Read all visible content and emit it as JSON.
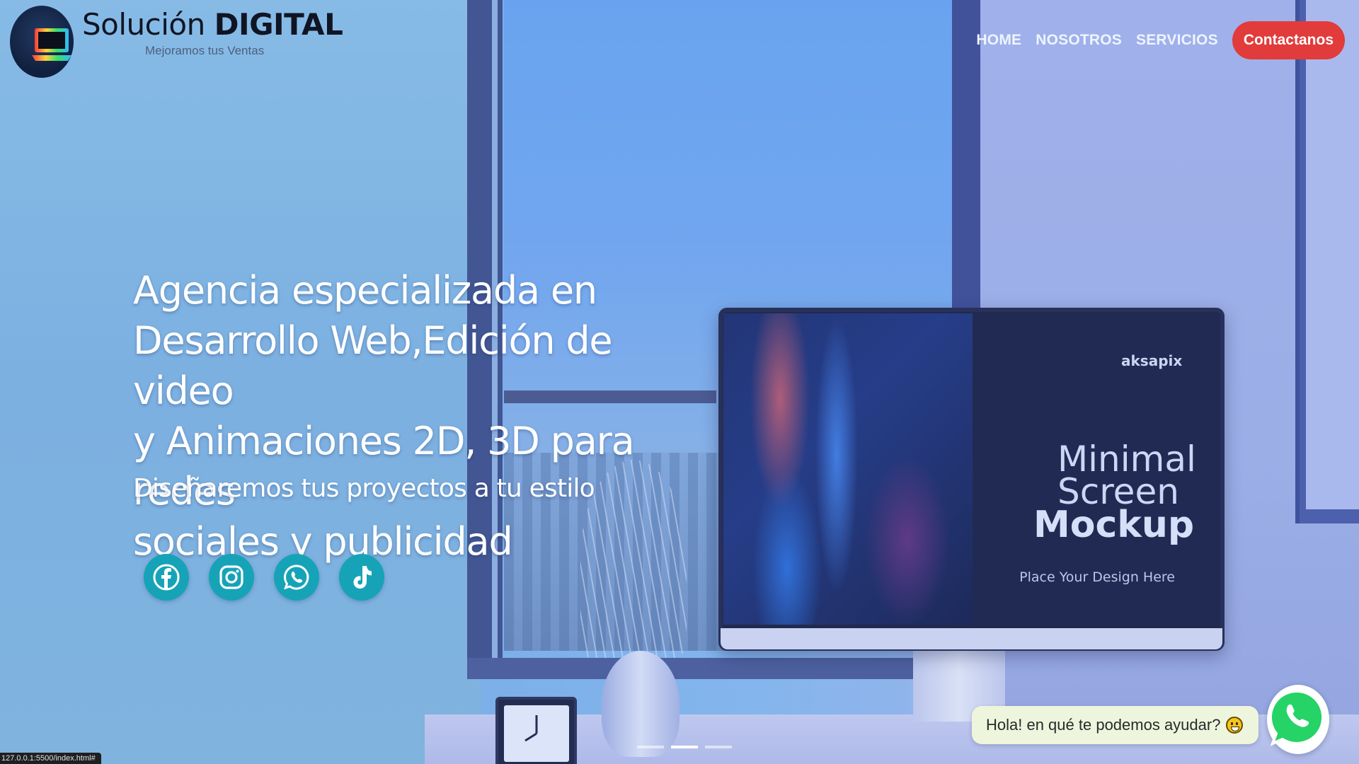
{
  "brand": {
    "name_light": "Solución ",
    "name_bold": "DIGITAL",
    "tagline": "Mejoramos tus Ventas",
    "logo_icon": "laptop-icon"
  },
  "nav": {
    "items": [
      {
        "label": "HOME"
      },
      {
        "label": "NOSOTROS"
      },
      {
        "label": "SERVICIOS"
      }
    ],
    "cta_label": "Contactanos",
    "cta_color": "#e23b3b"
  },
  "hero": {
    "title_lines": [
      "Agencia especializada en",
      "Desarrollo Web,Edición de video",
      "y Animaciones 2D, 3D para redes",
      "sociales y publicidad"
    ],
    "subtitle": "Diseñaremos tus proyectos a tu estilo",
    "image": {
      "brand": "aksapix",
      "title_line1": "Minimal",
      "title_line2": "Screen",
      "title_line3": "Mockup",
      "subtitle": "Place Your Design Here"
    }
  },
  "socials": {
    "accent": "#17a3b7",
    "icons": [
      "facebook-icon",
      "instagram-icon",
      "whatsapp-icon",
      "tiktok-icon"
    ]
  },
  "carousel": {
    "slide_count": 3,
    "active_index": 1
  },
  "chat": {
    "message": "Hola! en qué te podemos ayudar?",
    "emoji": "smiley-emoji",
    "fab_icon": "whatsapp-icon",
    "accent": "#25d366"
  },
  "status_bar": {
    "url": "127.0.0.1:5500/index.html#"
  }
}
